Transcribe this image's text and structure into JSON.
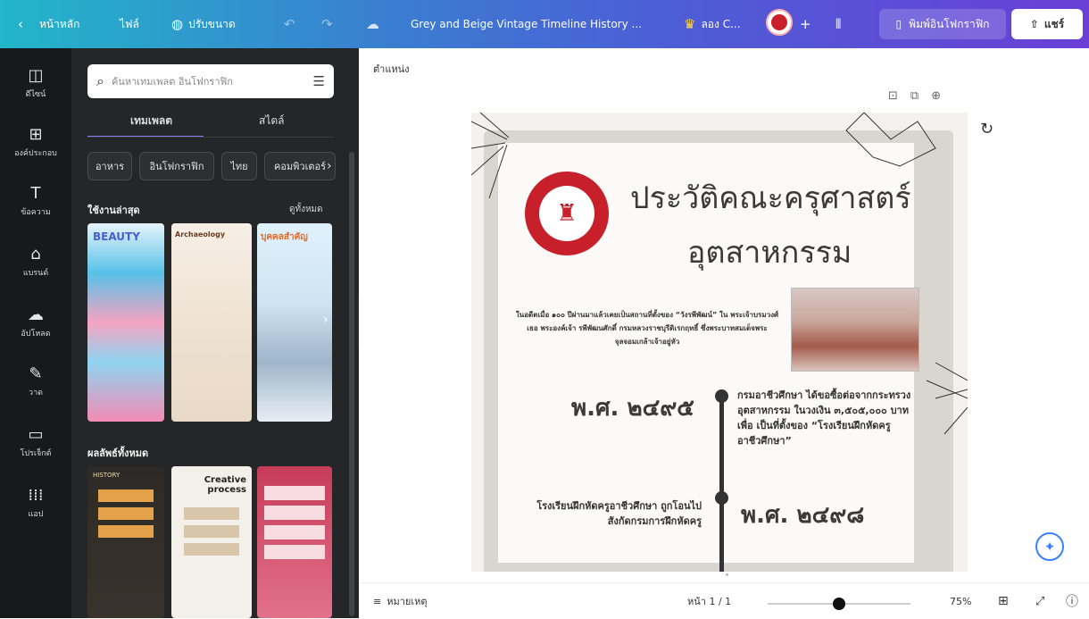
{
  "topbar": {
    "home_label": "หน้าหลัก",
    "file_label": "ไฟล์",
    "resize_label": "ปรับขนาด",
    "doc_title": "Grey and Beige Vintage Timeline History ...",
    "try_label": "ลอง C...",
    "print_label": "พิมพ์อินโฟกราฟิก",
    "share_label": "แชร์"
  },
  "rail": {
    "items": [
      {
        "label": "ดีไซน์",
        "icon": "layout-icon"
      },
      {
        "label": "องค์ประกอบ",
        "icon": "elements-icon"
      },
      {
        "label": "ข้อความ",
        "icon": "text-icon"
      },
      {
        "label": "แบรนด์",
        "icon": "brand-icon"
      },
      {
        "label": "อัปโหลด",
        "icon": "upload-icon"
      },
      {
        "label": "วาด",
        "icon": "draw-icon"
      },
      {
        "label": "โปรเจ็กต์",
        "icon": "folder-icon"
      },
      {
        "label": "แอป",
        "icon": "apps-icon"
      }
    ]
  },
  "panel": {
    "search_placeholder": "ค้นหาเทมเพลต อินโฟกราฟิก",
    "tabs": [
      "เทมเพลต",
      "สไตล์"
    ],
    "chips": [
      "อาหาร",
      "อินโฟกราฟิก",
      "ไทย",
      "คอมพิวเตอร์"
    ],
    "recent_title": "ใช้งานล่าสุด",
    "see_all": "ดูทั้งหมด",
    "all_results_title": "ผลลัพธ์ทั้งหมด",
    "recent_thumbs": [
      {
        "title": "BEAUTY"
      },
      {
        "title": "Archaeology"
      },
      {
        "title": "บุคคลสำคัญ"
      }
    ],
    "result_thumbs": [
      {
        "title": "HISTORY"
      },
      {
        "title": "Creative process"
      },
      {
        "title": ""
      }
    ]
  },
  "canvas": {
    "position_label": "ตำแหน่ง",
    "title_line1": "ประวัติคณะครุศาสตร์",
    "title_line2": "อุตสาหกรรม",
    "intro": "ในอดีตเมื่อ ๑๐๐ ปีผ่านมาแล้วเคยเป็นสถานที่ตั้งของ “วังรพีพัฒน์” ใน พระเจ้าบรมวงศ์เธอ พระองค์เจ้า รพีพัฒนศักดิ์ กรมหลวงราชบุรีดิเรกฤทธิ์ ซึ่งพระบาทสมเด็จพระจุลจอมเกล้าเจ้าอยู่หัว",
    "year1": "พ.ศ. ๒๔๙๕",
    "event1": "กรมอาชีวศึกษา ได้ขอซื้อต่อจากกระทรวงอุตสาหกรรม ในวงเงิน ๓,๕๐๕,๐๐๐ บาท เพื่อ เป็นที่ตั้งของ “โรงเรียนฝึกหัดครูอาชีวศึกษา”",
    "year2": "พ.ศ. ๒๔๙๘",
    "event2": "โรงเรียนฝึกหัดครูอาชีวศึกษา ถูกโอนไปสังกัดกรมการฝึกหัดครู"
  },
  "bottombar": {
    "notes_label": "หมายเหตุ",
    "page_label": "หน้า 1 / 1",
    "zoom_label": "75%",
    "zoom_fraction": 0.5
  }
}
